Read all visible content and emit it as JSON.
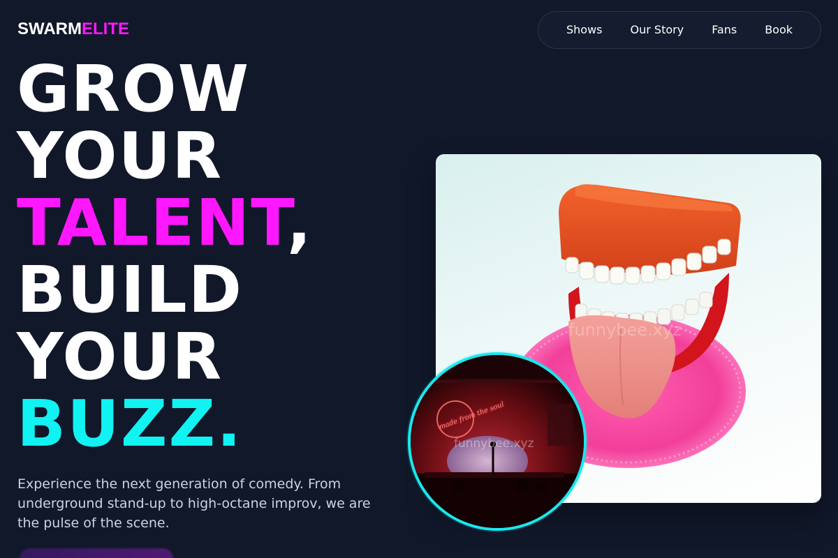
{
  "brand": {
    "part1": "SWARM",
    "part2": "ELITE"
  },
  "nav": {
    "items": [
      {
        "label": "Shows"
      },
      {
        "label": "Our Story"
      },
      {
        "label": "Fans"
      },
      {
        "label": "Book"
      }
    ]
  },
  "hero": {
    "line1": "GROW",
    "line2": "YOUR",
    "line3_highlight": "TALENT",
    "line3_punct": ",",
    "line4": "BUILD",
    "line5": "YOUR",
    "line6_highlight": "BUZZ.",
    "subtext": "Experience the next generation of comedy. From underground stand-up to high-octane improv, we are the pulse of the scene."
  },
  "images": {
    "main": {
      "subject": "wind-up-teeth-toy-photo",
      "watermark": "funnybee.xyz"
    },
    "circle": {
      "subject": "neon-lit-stage-photo",
      "watermark": "funnybee.xyz",
      "neon_sign": "made from the soul"
    }
  },
  "colors": {
    "background": "#11182a",
    "accent_pink": "#ff17ff",
    "accent_cyan": "#11f3f3",
    "text_primary": "#ffffff",
    "text_secondary": "#cdd3e0"
  }
}
